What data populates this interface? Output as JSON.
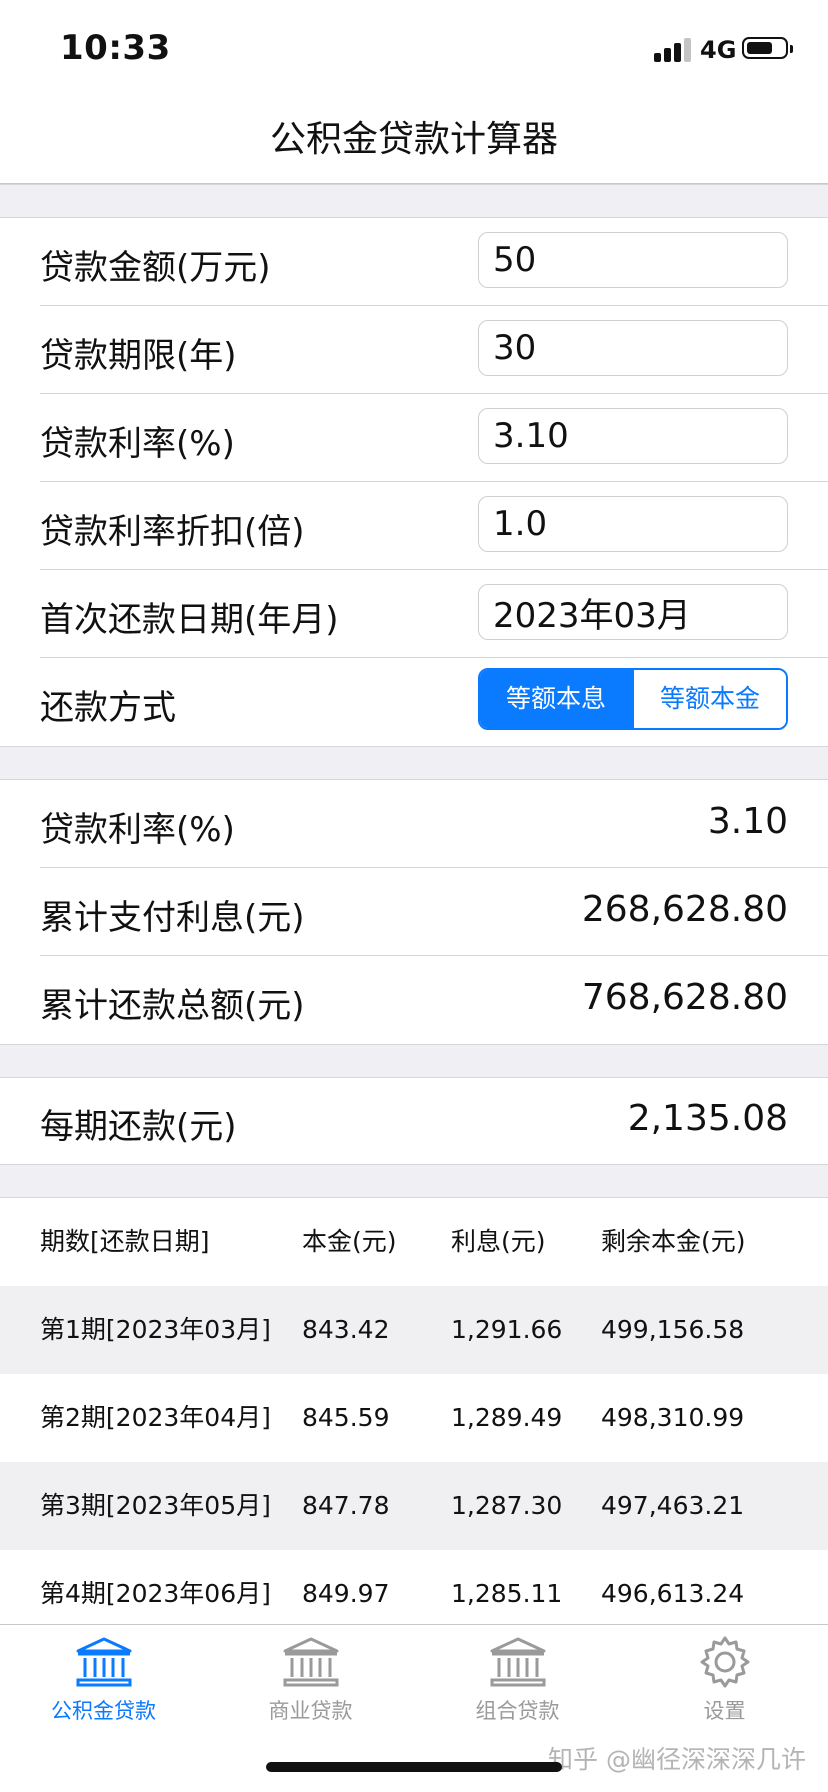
{
  "status_bar": {
    "time": "10:33",
    "network": "4G",
    "signal_bars": 3,
    "battery_level": 0.7
  },
  "nav": {
    "title": "公积金贷款计算器"
  },
  "inputs": {
    "amount": {
      "label": "贷款金额(万元)",
      "value": "50"
    },
    "term": {
      "label": "贷款期限(年)",
      "value": "30"
    },
    "rate": {
      "label": "贷款利率(%)",
      "value": "3.10"
    },
    "discount": {
      "label": "贷款利率折扣(倍)",
      "value": "1.0"
    },
    "first_date": {
      "label": "首次还款日期(年月)",
      "value": "2023年03月"
    },
    "method": {
      "label": "还款方式",
      "options": [
        "等额本息",
        "等额本金"
      ],
      "selected": "等额本息"
    }
  },
  "summary": {
    "rate": {
      "label": "贷款利率(%)",
      "value": "3.10"
    },
    "total_interest": {
      "label": "累计支付利息(元)",
      "value": "268,628.80"
    },
    "total_payment": {
      "label": "累计还款总额(元)",
      "value": "768,628.80"
    }
  },
  "monthly": {
    "label": "每期还款(元)",
    "value": "2,135.08"
  },
  "schedule": {
    "headers": [
      "期数[还款日期]",
      "本金(元)",
      "利息(元)",
      "剩余本金(元)"
    ],
    "rows": [
      [
        "第1期[2023年03月]",
        "843.42",
        "1,291.66",
        "499,156.58"
      ],
      [
        "第2期[2023年04月]",
        "845.59",
        "1,289.49",
        "498,310.99"
      ],
      [
        "第3期[2023年05月]",
        "847.78",
        "1,287.30",
        "497,463.21"
      ],
      [
        "第4期[2023年06月]",
        "849.97",
        "1,285.11",
        "496,613.24"
      ]
    ]
  },
  "tab_bar": {
    "tabs": [
      {
        "label": "公积金贷款",
        "icon": "bank-icon",
        "active": true
      },
      {
        "label": "商业贷款",
        "icon": "bank-icon",
        "active": false
      },
      {
        "label": "组合贷款",
        "icon": "bank-icon",
        "active": false
      },
      {
        "label": "设置",
        "icon": "gear-icon",
        "active": false
      }
    ]
  },
  "watermark": "知乎 @幽径深深深几许",
  "colors": {
    "accent": "#0a7aff",
    "inactive_tab": "#9a9a9a",
    "section_gap": "#efeff4",
    "row_shade": "#f0f0f2"
  }
}
